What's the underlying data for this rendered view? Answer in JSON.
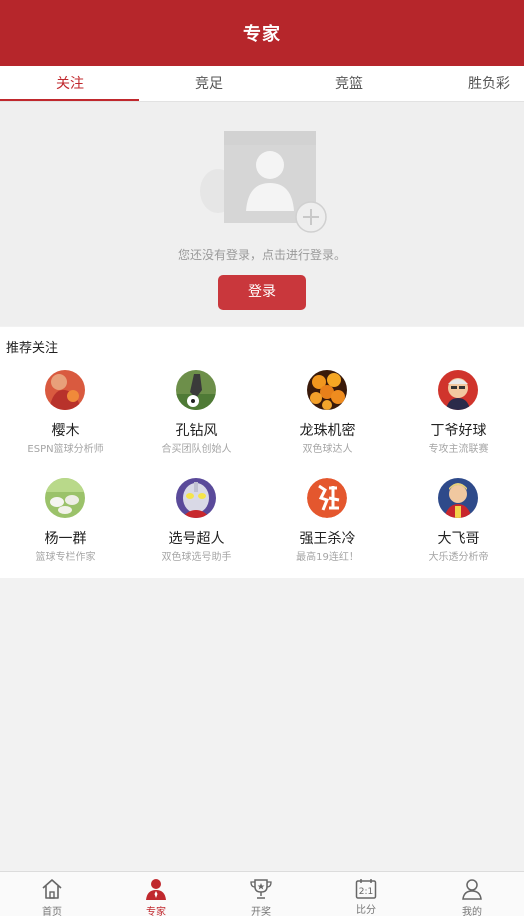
{
  "header": {
    "title": "专家"
  },
  "tabs": [
    {
      "label": "关注",
      "active": true
    },
    {
      "label": "竞足",
      "active": false
    },
    {
      "label": "竞篮",
      "active": false
    },
    {
      "label": "胜负彩",
      "active": false
    }
  ],
  "login": {
    "tip": "您还没有登录，点击进行登录。",
    "button": "登录"
  },
  "recommend": {
    "title": "推荐关注",
    "experts": [
      {
        "name": "樱木",
        "desc": "ESPN篮球分析师",
        "avatar": "avatar-red-basketball"
      },
      {
        "name": "孔钻风",
        "desc": "合买团队创始人",
        "avatar": "avatar-soccer-kick"
      },
      {
        "name": "龙珠机密",
        "desc": "双色球达人",
        "avatar": "avatar-dragon-balls"
      },
      {
        "name": "丁爷好球",
        "desc": "专攻主流联赛",
        "avatar": "avatar-cartoon-man"
      },
      {
        "name": "杨一群",
        "desc": "篮球专栏作家",
        "avatar": "avatar-sheep"
      },
      {
        "name": "选号超人",
        "desc": "双色球选号助手",
        "avatar": "avatar-ultraman"
      },
      {
        "name": "强王杀冷",
        "desc": "最高19连红！",
        "avatar": "avatar-red-calligraphy"
      },
      {
        "name": "大飞哥",
        "desc": "大乐透分析帝",
        "avatar": "avatar-player"
      }
    ]
  },
  "nav": [
    {
      "label": "首页",
      "icon": "home-icon",
      "active": false
    },
    {
      "label": "专家",
      "icon": "expert-icon",
      "active": true
    },
    {
      "label": "开奖",
      "icon": "trophy-icon",
      "active": false
    },
    {
      "label": "比分",
      "icon": "scoreboard-icon",
      "active": false
    },
    {
      "label": "我的",
      "icon": "user-icon",
      "active": false
    }
  ],
  "colors": {
    "brand": "#b6262b",
    "accent": "#c0282d",
    "button": "#c9373c"
  }
}
